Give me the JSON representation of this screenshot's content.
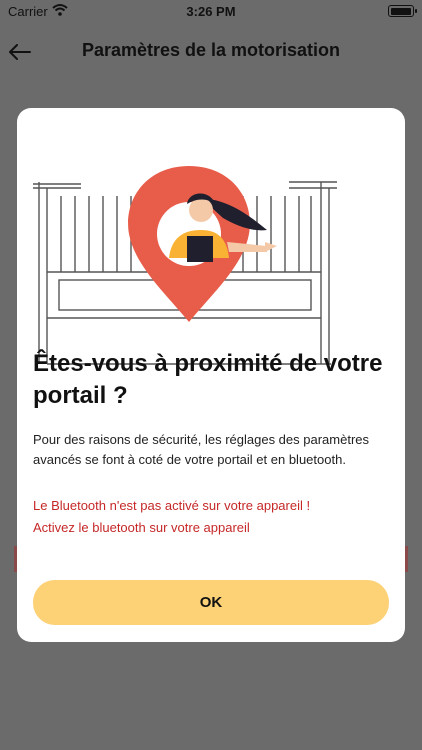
{
  "status_bar": {
    "carrier": "Carrier",
    "time": "3:26 PM"
  },
  "nav": {
    "title": "Paramètres de la motorisation"
  },
  "modal": {
    "title": "Êtes-vous à proximité de votre portail ?",
    "body": "Pour des raisons de sécurité, les réglages des paramètres avancés se font à coté de votre portail et en bluetooth.",
    "warning_1": "Le Bluetooth n'est pas activé sur votre appareil !",
    "warning_2": "Activez le bluetooth sur votre appareil",
    "ok_label": "OK"
  },
  "colors": {
    "overlay": "#6b6b6b",
    "button": "#fdd176",
    "warning": "#c62828",
    "pin": "#e85d4a"
  },
  "icons": [
    "wifi-icon",
    "battery-icon",
    "back-arrow-icon",
    "gate-location-illustration"
  ]
}
